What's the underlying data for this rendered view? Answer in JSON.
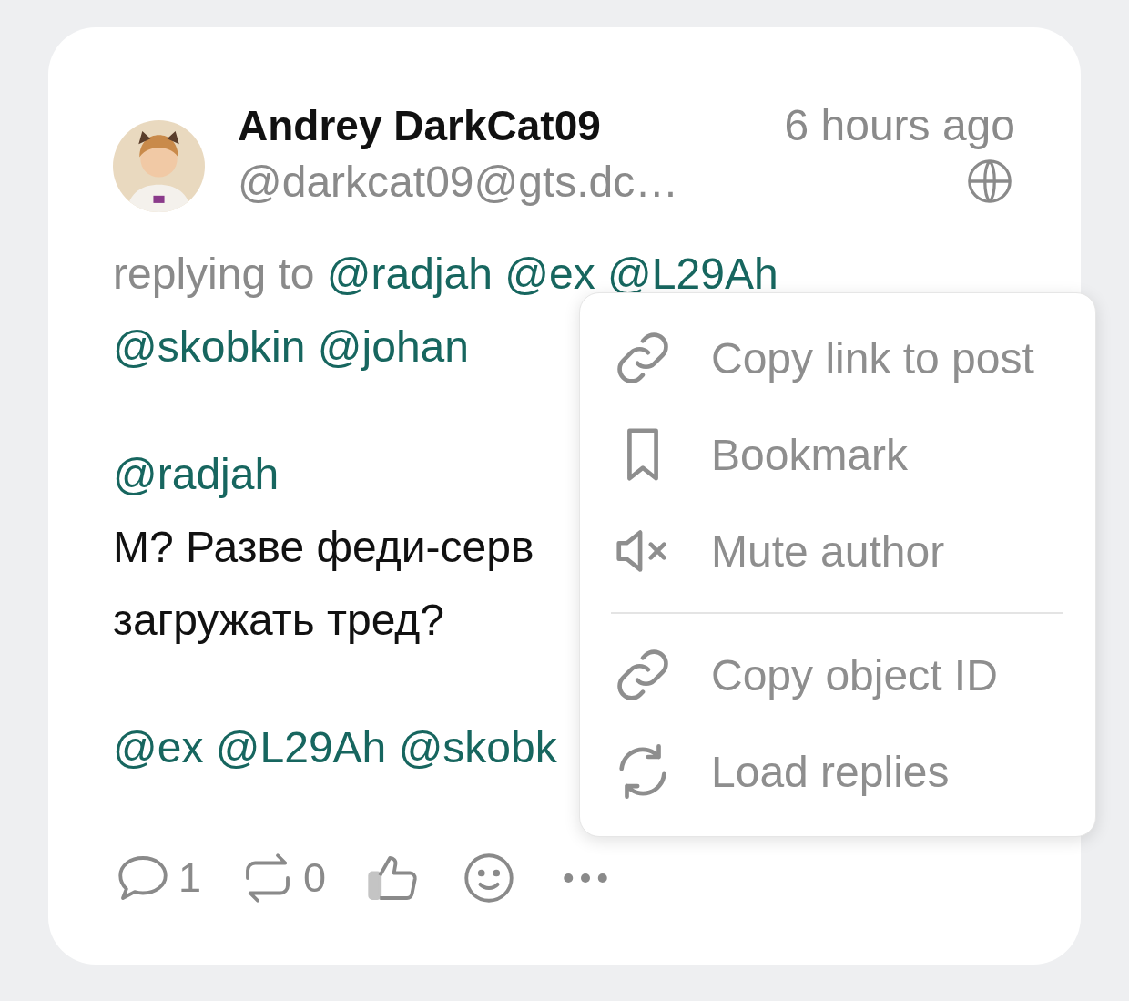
{
  "post": {
    "author": {
      "name": "Andrey DarkCat09",
      "handle": "@darkcat09@gts.dc…",
      "time": "6 hours ago"
    },
    "replying_to": {
      "label": "replying to",
      "mentions": [
        "@radjah",
        "@ex",
        "@L29Ah",
        "@skobkin",
        "@johan"
      ]
    },
    "paragraphs": [
      {
        "lines": [
          {
            "kind": "mentions",
            "mentions": [
              "@radjah"
            ]
          },
          {
            "kind": "text",
            "text": "М? Разве феди-серв"
          },
          {
            "kind": "text",
            "text": "загружать тред?"
          }
        ]
      },
      {
        "lines": [
          {
            "kind": "mentions",
            "mentions": [
              "@ex",
              "@L29Ah",
              "@skobk"
            ]
          }
        ]
      }
    ],
    "actions": [
      {
        "kind": "reply",
        "count": "1"
      },
      {
        "kind": "boost",
        "count": "0"
      },
      {
        "kind": "like"
      },
      {
        "kind": "react"
      },
      {
        "kind": "more"
      }
    ]
  },
  "menu": {
    "groups": [
      [
        {
          "kind": "link",
          "label": "Copy link to post"
        },
        {
          "kind": "bookmark",
          "label": "Bookmark"
        },
        {
          "kind": "mute",
          "label": "Mute author"
        }
      ],
      [
        {
          "kind": "link",
          "label": "Copy object ID"
        },
        {
          "kind": "refresh",
          "label": "Load replies"
        }
      ]
    ]
  }
}
